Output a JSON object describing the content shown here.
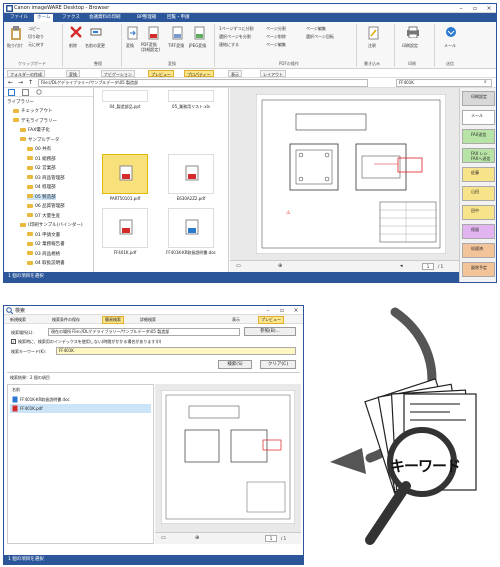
{
  "main_window": {
    "title": "Canon imageWARE Desktop - Browser",
    "tabs": [
      "ファイル",
      "ホーム",
      "ファクス",
      "会議資料の印刷",
      "BP整理箱",
      "回覧・申請"
    ],
    "active_tab": "ホーム",
    "ribbon": {
      "clipboard": {
        "paste": "貼り付け",
        "copy": "コピー",
        "cut": "切り取り",
        "undo": "元に戻す",
        "group": "クリップボード"
      },
      "organize": {
        "delete": "削除",
        "rename": "名前の変更",
        "group": "整理"
      },
      "convert": {
        "convert": "変換",
        "pdf_convert": "PDF変換\n(詳細設定)",
        "tiff_convert": "TIFF変換",
        "jpeg_convert": "JPEG変換",
        "group": "変換"
      },
      "pdf_ops": {
        "split_pages": "1ページずつに分割",
        "insert_pages": "選択ページを分割",
        "merge": "連結にする",
        "page_split": "ページ分割",
        "page_delete": "ページ削除",
        "page_edit": "ページ編集",
        "select_page_edit": "選択ページ回転",
        "group": "PDFの操作"
      },
      "write": {
        "note": "注釈",
        "group": "書き込み"
      },
      "print": {
        "print_settings": "印刷設定",
        "group": "印刷"
      },
      "mail": {
        "mail": "メール",
        "group": "送信"
      }
    },
    "subtoolbar": {
      "new_folder": "フォルダーの作成",
      "convert": "変換",
      "navigation": "ナビゲーション",
      "preview": "プレビュー",
      "properties": "プロパティー",
      "view": "表示",
      "layout": "レイアウト"
    },
    "address": "File://DLゲデライブラリー/サンプルデータ\\05 製造部",
    "search_value": "FF401K",
    "tree": {
      "header": "ライブラリー",
      "items": [
        {
          "label": "チェックアウト",
          "level": 1
        },
        {
          "label": "デモライブラリー",
          "level": 1
        },
        {
          "label": "FAX電子化",
          "level": 2
        },
        {
          "label": "サンプルデータ",
          "level": 2
        },
        {
          "label": "00 共有",
          "level": 3
        },
        {
          "label": "01 総務部",
          "level": 3
        },
        {
          "label": "02 営業部",
          "level": 3
        },
        {
          "label": "03 商品管理部",
          "level": 3
        },
        {
          "label": "04 経理部",
          "level": 3
        },
        {
          "label": "05 製造部",
          "level": 3,
          "selected": true
        },
        {
          "label": "06 品質管理部",
          "level": 3
        },
        {
          "label": "07 大量生産",
          "level": 3
        },
        {
          "label": "(印刷サンプル(バインダー)",
          "level": 2
        },
        {
          "label": "01 申請文書",
          "level": 3
        },
        {
          "label": "02 業務報告書",
          "level": 3
        },
        {
          "label": "03 商品規格",
          "level": 3
        },
        {
          "label": "04 取扱説明書",
          "level": 3
        }
      ]
    },
    "files": [
      {
        "name": "04_製造部品.ppt",
        "type": "ppt"
      },
      {
        "name": "05_業務用リスト.xls",
        "type": "xls"
      },
      {
        "name": "PART50101.pdf",
        "type": "pdf",
        "selected": true
      },
      {
        "name": "E630A2Z2.pdf",
        "type": "pdf"
      },
      {
        "name": "FF401K.pdf",
        "type": "pdf"
      },
      {
        "name": "FF401K-KR取扱説明書.doc",
        "type": "doc"
      }
    ],
    "trays": [
      {
        "label": "印刷設定",
        "color": "#d8d8d8"
      },
      {
        "label": "メール",
        "color": "#ffffff"
      },
      {
        "label": "FAX送信",
        "color": "#b7e4a6"
      },
      {
        "label": "FAX レシ\nFAXへ送信",
        "color": "#b7e4a6"
      },
      {
        "label": "佐藤",
        "color": "#f7e38a"
      },
      {
        "label": "山田",
        "color": "#f7e38a"
      },
      {
        "label": "田中",
        "color": "#f7e38a"
      },
      {
        "label": "保留",
        "color": "#e3b5f0"
      },
      {
        "label": "処理済",
        "color": "#f3c49a"
      },
      {
        "label": "副除予定",
        "color": "#f3c49a"
      }
    ],
    "pager": {
      "page": "1",
      "total": "/ 1"
    },
    "status": "1 個の項目を選択"
  },
  "search_dialog": {
    "title": "検索",
    "toolbar": {
      "new_search": "新規検索",
      "save_conditions": "検索条件の保存",
      "quick_search": "簡易検索",
      "detail_search": "詳細検索",
      "view": "表示",
      "preview": "プレビュー"
    },
    "location_label": "検索場所(L):",
    "location_value": "現在の場所  File://DLゲデライブラリー/サンプルデータ\\05 製造部",
    "browse": "参照(B)...",
    "checkbox_label": "検索時に、検索用のインデックスを使用しない(時間がかかる場合があります)(I)",
    "keyword_label": "検索キーワード(K):",
    "keyword_value": "FF401K",
    "search_button": "検索(S)",
    "clear_button": "クリア(C)",
    "result_label": "検索結果：2 個の項目",
    "name_col": "名前",
    "results": [
      "FF401K-KR取扱説明書.doc",
      "FF401K.pdf"
    ],
    "pager": {
      "page": "1",
      "total": "/ 1"
    },
    "status": "1 個の項目を選択"
  },
  "illustration": {
    "keyword_text": "キーワード"
  }
}
